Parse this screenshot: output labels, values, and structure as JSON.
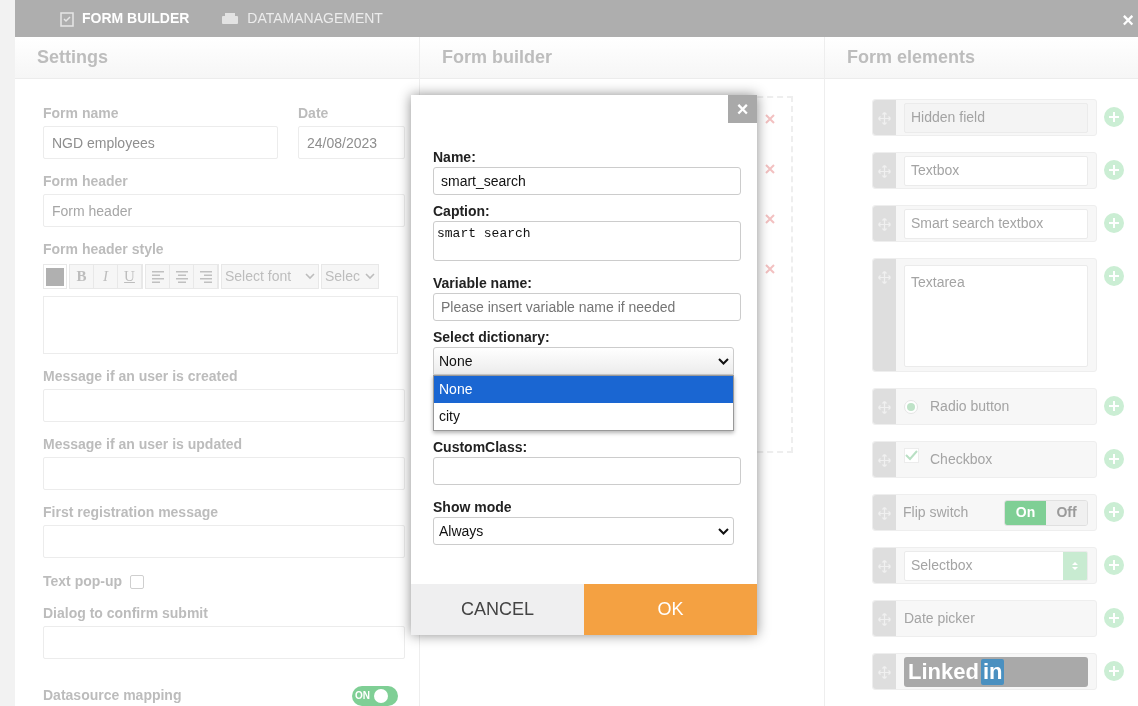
{
  "top_bar": {
    "tabs": [
      {
        "label": "FORM BUILDER",
        "selected": true
      },
      {
        "label": "DATAMANAGEMENT",
        "selected": false
      }
    ],
    "close": "×"
  },
  "settings": {
    "title": "Settings",
    "form_name": {
      "label": "Form name",
      "value": "NGD employees"
    },
    "date": {
      "label": "Date",
      "value": "24/08/2023"
    },
    "form_header": {
      "label": "Form header",
      "placeholder": "Form header"
    },
    "header_style": {
      "label": "Form header style",
      "tools": [
        "B",
        "I",
        "U"
      ],
      "font_select": "Select font",
      "size_select": "Selec"
    },
    "messages": [
      {
        "label": "Message if an user is created"
      },
      {
        "label": "Message if an user is updated"
      },
      {
        "label": "First registration message"
      }
    ],
    "text_popup": {
      "label": "Text pop-up",
      "checked": false
    },
    "confirm_dialog": {
      "label": "Dialog to confirm submit"
    },
    "datasource_mapping": {
      "label": "Datasource mapping",
      "toggle": "ON",
      "on": true
    }
  },
  "form_builder": {
    "title": "Form builder"
  },
  "form_elements": {
    "title": "Form elements",
    "items": [
      {
        "kind": "hidden",
        "label": "Hidden field"
      },
      {
        "kind": "textbox",
        "label": "Textbox"
      },
      {
        "kind": "textbox",
        "label": "Smart search textbox"
      },
      {
        "kind": "textarea",
        "label": "Textarea"
      },
      {
        "kind": "radio",
        "label": "Radio button",
        "checked": true
      },
      {
        "kind": "checkbox",
        "label": "Checkbox",
        "checked": true
      },
      {
        "kind": "flip",
        "label": "Flip switch",
        "on_label": "On",
        "off_label": "Off",
        "on": true
      },
      {
        "kind": "select",
        "label": "Selectbox"
      },
      {
        "kind": "plain",
        "label": "Date picker"
      },
      {
        "kind": "linkedin",
        "label": "Linked",
        "badge": "in"
      }
    ]
  },
  "dialog": {
    "close": "×",
    "fields": [
      {
        "kind": "text",
        "label": "Name:",
        "value": "smart_search"
      },
      {
        "kind": "textarea",
        "label": "Caption:",
        "value": "smart search"
      },
      {
        "kind": "text",
        "label": "Variable name:",
        "placeholder": "Please insert variable name if needed"
      },
      {
        "kind": "select",
        "label": "Select dictionary:",
        "value": "None",
        "expanded": true,
        "options": [
          {
            "label": "None",
            "selected": true
          },
          {
            "label": "city",
            "selected": false
          }
        ]
      },
      {
        "kind": "text",
        "label": "CustomClass:"
      },
      {
        "kind": "select",
        "label": "Show mode",
        "value": "Always"
      }
    ],
    "cancel": "CANCEL",
    "ok": "OK"
  }
}
